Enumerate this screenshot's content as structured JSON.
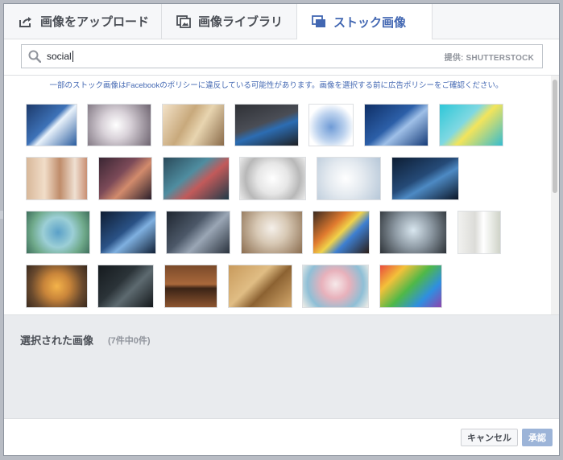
{
  "tabs": [
    {
      "label": "画像をアップロード",
      "icon": "upload-icon",
      "active": false
    },
    {
      "label": "画像ライブラリ",
      "icon": "library-icon",
      "active": false
    },
    {
      "label": "ストック画像",
      "icon": "stock-icon",
      "active": true
    }
  ],
  "search": {
    "value": "social",
    "provider": "提供: SHUTTERSTOCK",
    "icon": "search-icon"
  },
  "notice": "一部のストック画像はFacebookのポリシーに違反している可能性があります。画像を選択する前に広告ポリシーをご確認ください。",
  "thumbnails_row_count": 4,
  "selected": {
    "title": "選択された画像",
    "count": "(7件中0件)"
  },
  "footer": {
    "cancel_label": "キャンセル",
    "ok_label": "承認"
  },
  "colors": {
    "accent": "#4267b2",
    "ok_disabled": "#9cb4d8",
    "panel_bg": "#e9ebee"
  }
}
